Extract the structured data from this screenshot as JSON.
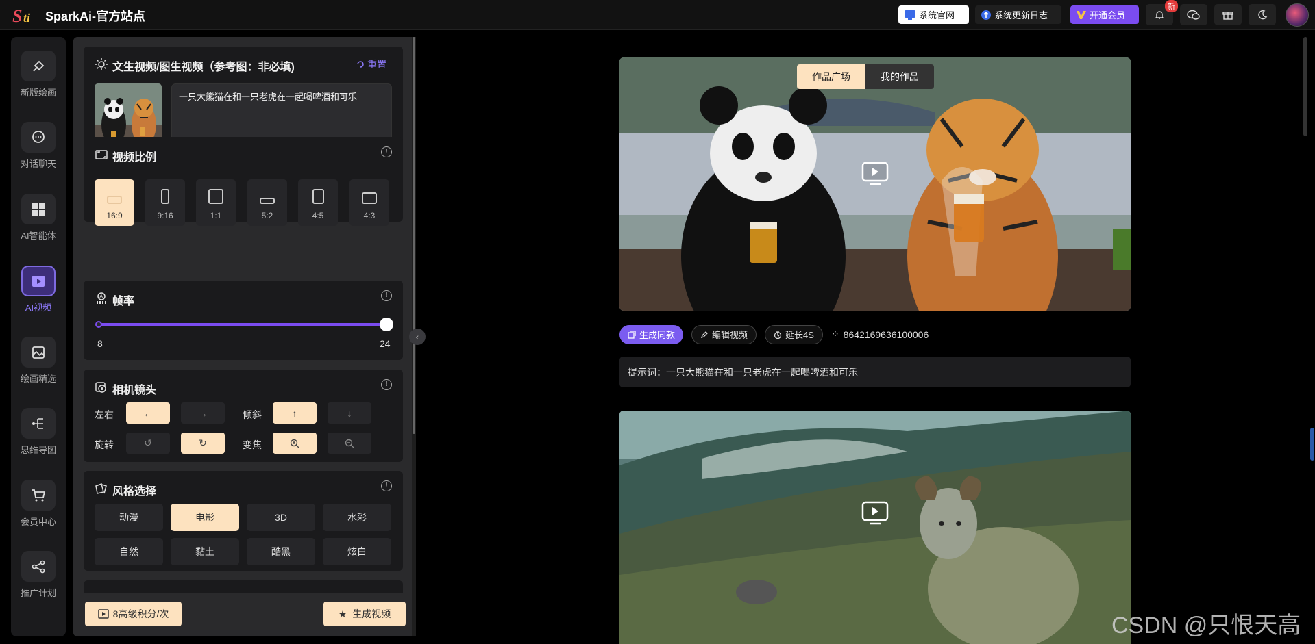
{
  "app": {
    "title": "SparkAi-官方站点"
  },
  "header": {
    "site_button": "系统官网",
    "changelog_button": "系统更新日志",
    "vip_button": "开通会员",
    "badge_new": "新"
  },
  "nav": {
    "items": [
      {
        "label": "新版绘画",
        "icon": "brush-icon"
      },
      {
        "label": "对话聊天",
        "icon": "chat-icon"
      },
      {
        "label": "AI智能体",
        "icon": "grid-icon"
      },
      {
        "label": "AI视频",
        "icon": "video-icon",
        "active": true
      },
      {
        "label": "绘画精选",
        "icon": "gallery-icon"
      },
      {
        "label": "思维导图",
        "icon": "mindmap-icon"
      },
      {
        "label": "会员中心",
        "icon": "cart-icon"
      },
      {
        "label": "推广计划",
        "icon": "share-icon"
      }
    ]
  },
  "panel": {
    "prompt_card": {
      "title": "文生视频/图生视频（参考图：非必填)",
      "reset": "重置",
      "prompt_value": "一只大熊猫在和一只老虎在一起喝啤酒和可乐"
    },
    "ratio_card": {
      "title": "视频比例",
      "options": [
        "16:9",
        "9:16",
        "1:1",
        "5:2",
        "4:5",
        "4:3"
      ],
      "selected": "16:9"
    },
    "fps_card": {
      "title": "帧率",
      "min": "8",
      "max": "24",
      "value_fraction": 1.0
    },
    "camera_card": {
      "title": "相机镜头",
      "pan_label": "左右",
      "tilt_label": "倾斜",
      "rotate_label": "旋转",
      "zoom_label": "变焦"
    },
    "style_card": {
      "title": "风格选择",
      "options": [
        "动漫",
        "电影",
        "3D",
        "水彩",
        "自然",
        "黏土",
        "酷黑",
        "炫白"
      ],
      "selected": "电影"
    },
    "cost_button": "8高级积分/次",
    "generate_button": "生成视频"
  },
  "main": {
    "tabs": [
      "作品广场",
      "我的作品"
    ],
    "active_tab": "作品广场",
    "actions": {
      "same_style": "生成同款",
      "edit_video": "编辑视频",
      "extend": "延长4S",
      "seed": "8642169636100006"
    },
    "prompt_line": "提示词：一只大熊猫在和一只老虎在一起喝啤酒和可乐"
  },
  "watermark": "CSDN @只恨天高",
  "colors": {
    "accent": "#7b4cf0",
    "highlight": "#fde2bf",
    "panel": "#2a2a2c"
  }
}
